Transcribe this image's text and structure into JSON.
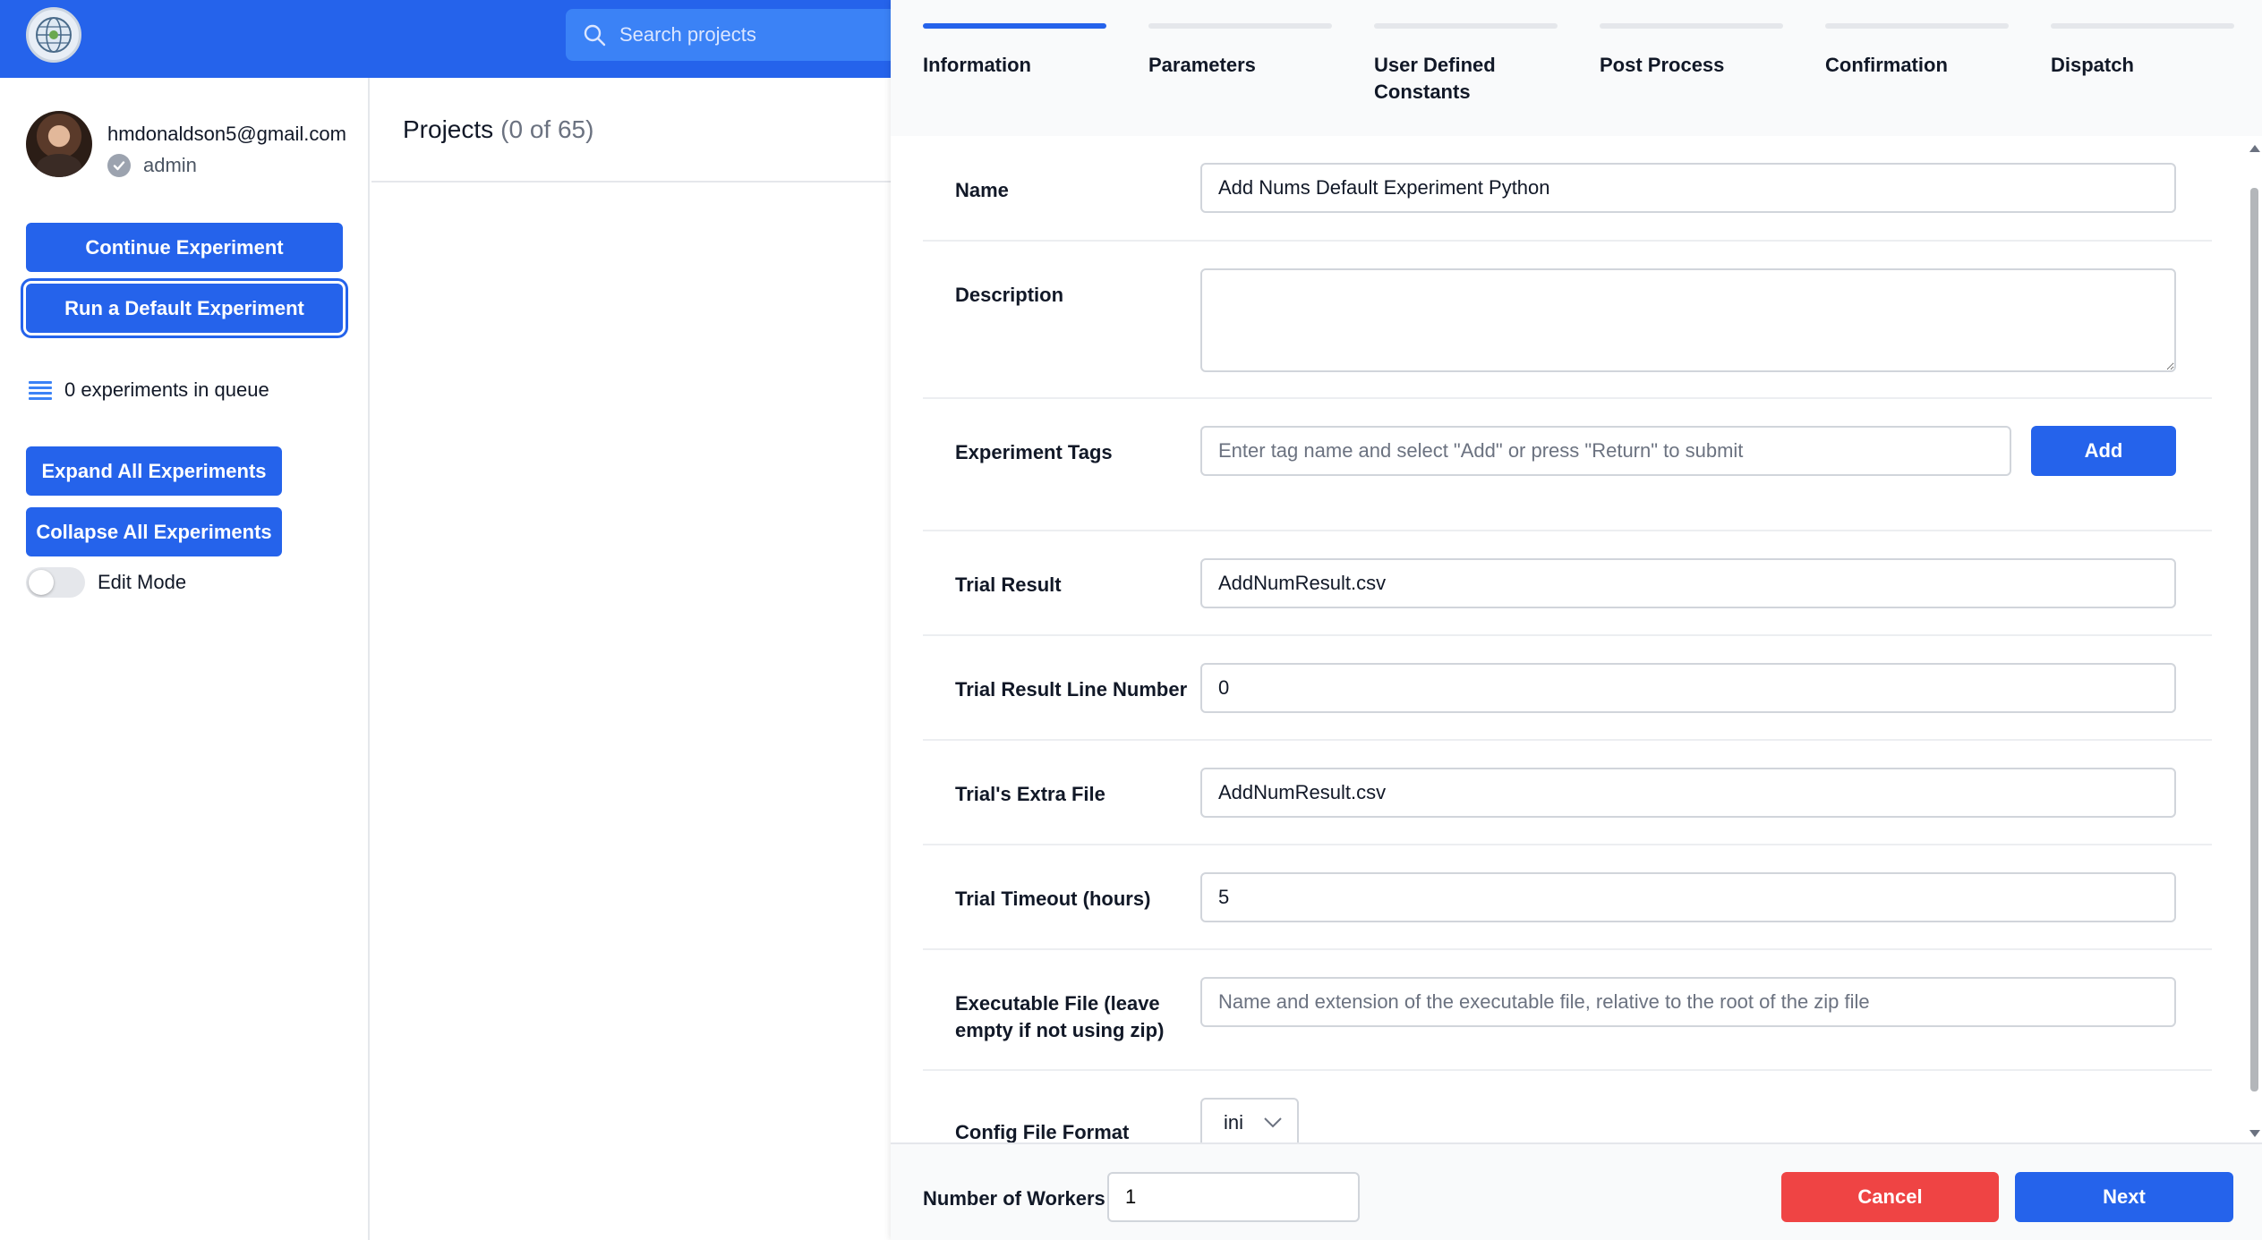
{
  "header": {
    "logo_icon": "globe-logo-icon",
    "search": {
      "placeholder": "Search projects",
      "icon": "search-icon"
    }
  },
  "user": {
    "email": "hmdonaldson5@gmail.com",
    "role": "admin"
  },
  "sidebar": {
    "continue_label": "Continue Experiment",
    "default_label": "Run a Default Experiment",
    "queue_text": "0 experiments in queue",
    "expand_label": "Expand All Experiments",
    "collapse_label": "Collapse All Experiments",
    "edit_mode_label": "Edit Mode",
    "edit_mode_on": false
  },
  "projects": {
    "title": "Projects",
    "count": "(0 of 65)"
  },
  "modal": {
    "steps": [
      {
        "label": "Information",
        "active": true
      },
      {
        "label": "Parameters",
        "active": false
      },
      {
        "label": "User Defined Constants",
        "active": false
      },
      {
        "label": "Post Process",
        "active": false
      },
      {
        "label": "Confirmation",
        "active": false
      },
      {
        "label": "Dispatch",
        "active": false
      }
    ],
    "form": {
      "name": {
        "label": "Name",
        "value": "Add Nums Default Experiment Python"
      },
      "description": {
        "label": "Description",
        "value": ""
      },
      "tags": {
        "label": "Experiment Tags",
        "placeholder": "Enter tag name and select \"Add\" or press \"Return\" to submit",
        "add_label": "Add"
      },
      "trial_result": {
        "label": "Trial Result",
        "value": "AddNumResult.csv"
      },
      "trial_result_line": {
        "label": "Trial Result Line Number",
        "value": "0"
      },
      "trial_extra_file": {
        "label": "Trial's Extra File",
        "value": "AddNumResult.csv"
      },
      "trial_timeout": {
        "label": "Trial Timeout (hours)",
        "value": "5"
      },
      "executable_file": {
        "label": "Executable File (leave empty if not using zip)",
        "placeholder": "Name and extension of the executable file, relative to the root of the zip file"
      },
      "config_format": {
        "label": "Config File Format",
        "value": "ini"
      }
    },
    "footer": {
      "workers_label": "Number of Workers",
      "workers_value": "1",
      "cancel_label": "Cancel",
      "next_label": "Next"
    }
  },
  "colors": {
    "primary": "#2563eb",
    "danger": "#ef4444",
    "header_bg": "#2563eb"
  }
}
